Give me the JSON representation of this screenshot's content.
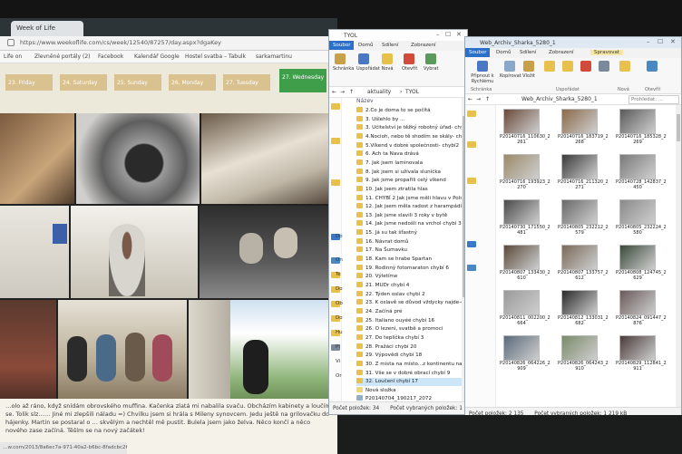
{
  "browser": {
    "tab_title": "Week of Life",
    "url": "https://www.weekoflife.com/cs/week/12540/87257/day.aspx?dgaKey",
    "bookmarks": [
      "Life on",
      "Zlevněné portály (2)",
      "Facebook",
      "Kalendář Google",
      "Hostel svatba – Tabulk",
      "sarkamartinu"
    ],
    "days": [
      "23. Friday",
      "24. Saturday",
      "25. Sunday",
      "26. Monday",
      "27. Tuesday",
      "27. Wednesday"
    ],
    "active_day_index": 5,
    "caption": "…olo až ráno, když snídám obrovského muffina. Kačenka zlatá mi nabalila svaču. Obcházím kabinety a loučím se. Tolik slz…… Jiné mi zlepšili náladu =) Chvilku jsem si hrála s Mileny synovcem. Jedu ještě na grilovačku do hájenky. Martin se postaral o … skvělým a nechtěl mě pustit. Bulela jsem jako želva. Něco končí a něco nového zase začíná. Těším se na nový začátek!",
    "status_url": "…w.com/2013/8a6ec7a-971-40a2-b6bc-8fadcbc263223.jpg"
  },
  "explorer1": {
    "title": "TYOL",
    "tabs": [
      "Soubor",
      "Domů",
      "Sdílení",
      "Zobrazení"
    ],
    "ribbon": [
      "Schránka",
      "Uspořádat",
      "Nová",
      "Otevřít",
      "Vybrat"
    ],
    "path": [
      "aktuality",
      "TYOL"
    ],
    "column_header": "Název",
    "items": [
      "2.Co je doma to se počítá",
      "3. Ušlehlo by ...",
      "3. Učitelství je těžký robotný úřad- chybí 4",
      "4.Nocioh, nebo tě shodím se skály- chybí 6",
      "5.Víkend v dobré společnosti- chybí2",
      "6. Ach ta Nava drává",
      "7. Jak jsem laminovala",
      "8. Jak jsem si užívala sluníčka",
      "9. Jak jsme propařili celý víkend",
      "10. Jak jsem ztratila hlas",
      "11. CHYBÍ 2 Jak jsme měli hlavu v Polsku - chybí 7",
      "12. Jak jsem měla radost z harampádí-2",
      "13. Jak jsme slavili 3 roky v bytě",
      "14. Jak jsme nedošli na vrchol chybí 3",
      "15. Já su tak šťastný",
      "16. Návrat domů",
      "17. Na Šumavku",
      "18. Kam se hrabe Spartan",
      "19. Rodinný fotomaraton chybí 6",
      "20. Výletíme",
      "21. MUDr chybí 4",
      "22. Týden oslav chybí 2",
      "23. K oslavě se důvod vždycky najde-4",
      "24. Začíná pré",
      "25. Italiano ouyéé chybí 16",
      "26. O lezení, svatbě a promoci",
      "27. Do teplíčka chybí 3",
      "28. Pražáci chybí 20",
      "29. Výpovědi chybí 18",
      "30. Z místa na místo...z kontinentu na ko...",
      "31. Vše se v dobré obrací chybí 9",
      "32. Loučení chybí 17",
      "Nová složka",
      "P20140704_190217_2072"
    ],
    "selected_index": 31,
    "nav": [
      "Do",
      "On",
      "Te",
      "Do",
      "Ob",
      "Do",
      "Hu",
      "Pl",
      "Vi",
      "Or"
    ],
    "status_count": "Počet položek: 34",
    "status_selected": "Počet vybraných položek: 1"
  },
  "explorer2": {
    "title": "Web_Archiv_Sharka_5280_1",
    "tabs": [
      "Soubor",
      "Domů",
      "Sdílení",
      "Zobrazení",
      "Spravovat"
    ],
    "ribbon_groups": [
      "Schránka",
      "Uspořádat",
      "Nová",
      "Otevřít"
    ],
    "ribbon": [
      "Připnout k Rychlému",
      "Kopírovat",
      "Vložit",
      "Přesunout do",
      "Kopírovat do",
      "Odstranit",
      "Přejmenovat",
      "Nová složka",
      "Vlastnosti"
    ],
    "path": [
      "Web_Archiv_Sharka_5280_1"
    ],
    "search_placeholder": "Prohledat: ...",
    "tiles": [
      {
        "name": "P20140716_110630_2",
        "num": "261"
      },
      {
        "name": "P20140716_183719_2",
        "num": "268"
      },
      {
        "name": "P20140716_185328_2",
        "num": "269"
      },
      {
        "name": "P20140716_193923_2",
        "num": "270"
      },
      {
        "name": "P20140716_211320_2",
        "num": "271"
      },
      {
        "name": "P20140728_142837_2",
        "num": "450"
      },
      {
        "name": "P20140730_171550_2",
        "num": "481"
      },
      {
        "name": "P20140805_232212_2",
        "num": "579"
      },
      {
        "name": "P20140805_232224_2",
        "num": "580"
      },
      {
        "name": "P20140807_133430_2",
        "num": "610"
      },
      {
        "name": "P20140807_133757_2",
        "num": "612"
      },
      {
        "name": "P20140808_124745_2",
        "num": "629"
      },
      {
        "name": "P20140811_002200_2",
        "num": "664"
      },
      {
        "name": "P20140812_133031_2",
        "num": "682"
      },
      {
        "name": "P20140824_091447_2",
        "num": "876"
      },
      {
        "name": "P20140826_064226_2",
        "num": "909"
      },
      {
        "name": "P20140826_064243_2",
        "num": "910"
      },
      {
        "name": "P20140829_112841_2",
        "num": "911"
      }
    ],
    "status_count": "Počet položek: 2 135",
    "status_selected": "Počet vybraných položek: 1 219 kB"
  },
  "colors": {
    "active_day": "#3e9e4a",
    "day_tab": "#d9c28f",
    "file_tab": "#2a6fc9",
    "folder": "#e8c14c",
    "selection": "#cde6f7"
  }
}
